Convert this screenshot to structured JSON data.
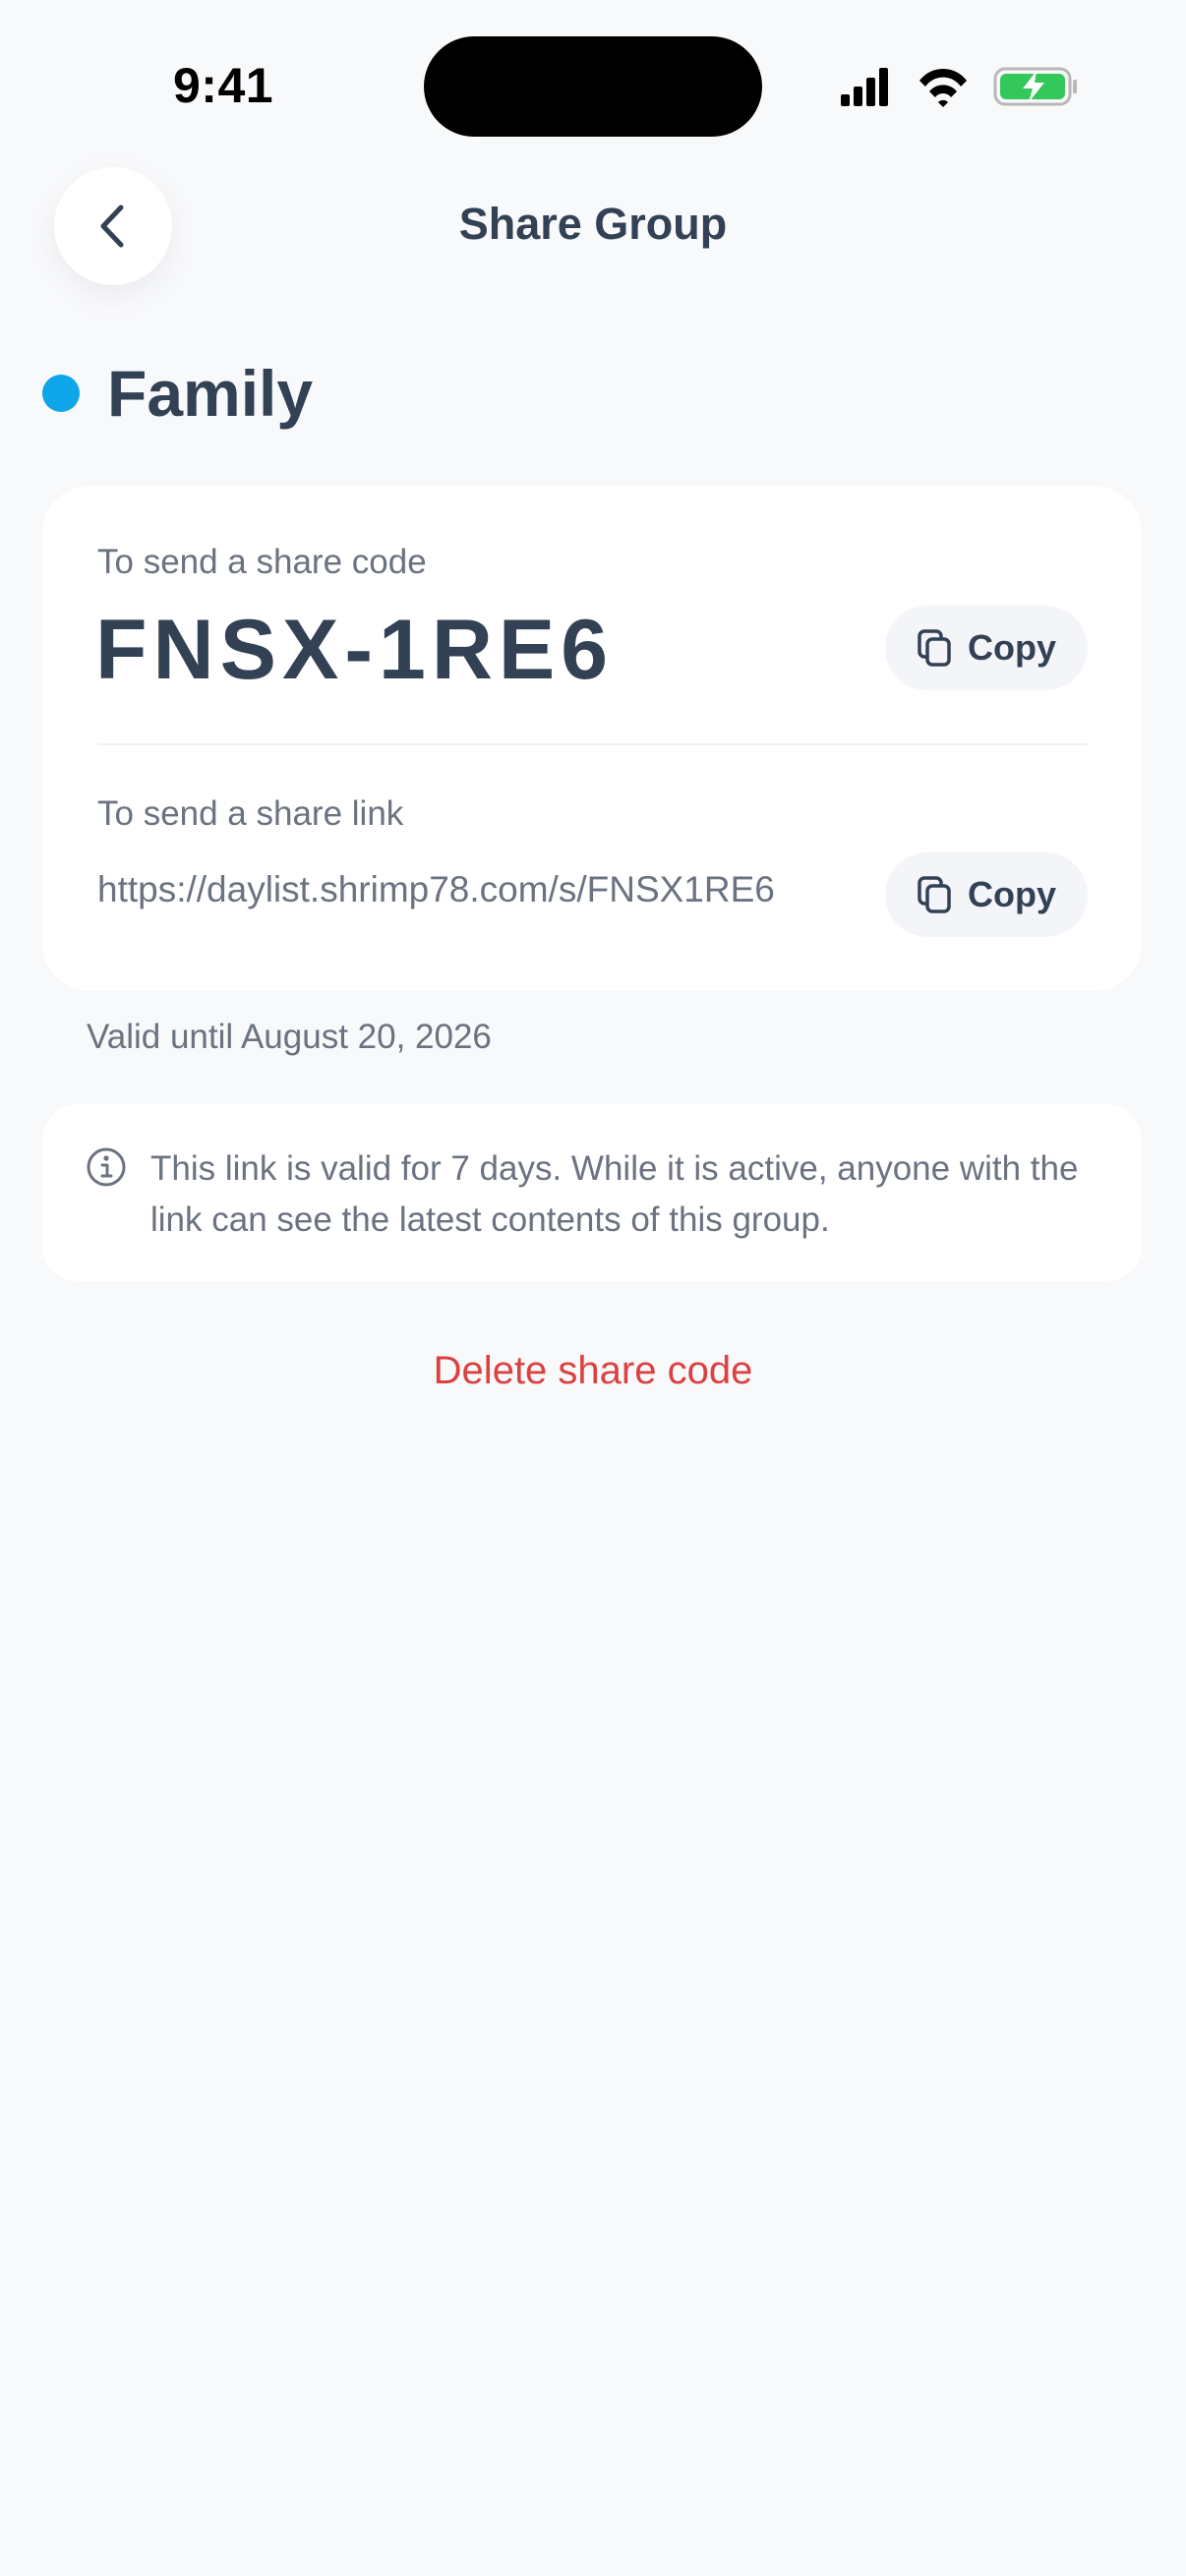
{
  "status_bar": {
    "time": "9:41"
  },
  "nav": {
    "title": "Share Group"
  },
  "group": {
    "name": "Family",
    "color": "#0ea5e9"
  },
  "share": {
    "code_label": "To send a share code",
    "code": "FNSX-1RE6",
    "copy_label": "Copy",
    "link_label": "To send a share link",
    "link": "https://daylist.shrimp78.com/s/FNSX1RE6"
  },
  "validity": {
    "valid_until": "Valid until August 20, 2026",
    "info": "This link is valid for 7 days. While it is active, anyone with the link can see the latest contents of this group."
  },
  "actions": {
    "delete_label": "Delete share code"
  },
  "colors": {
    "background": "#f8f9fb",
    "text_primary": "#334155",
    "text_secondary": "#6b7280",
    "danger": "#dc4040",
    "battery": "#34c759"
  }
}
